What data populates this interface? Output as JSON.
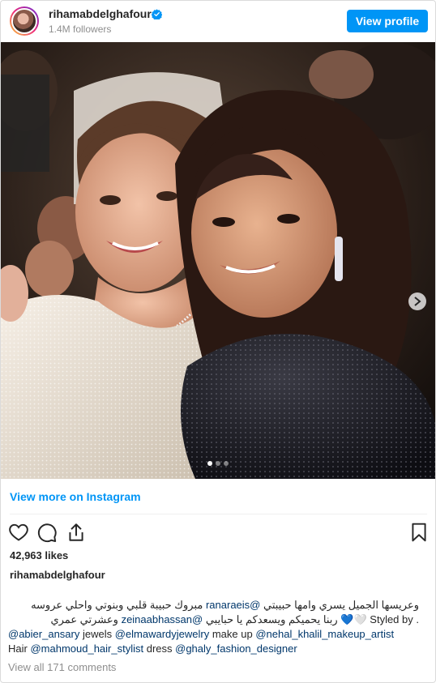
{
  "header": {
    "username": "rihamabdelghafour",
    "followers": "1.4M followers",
    "view_profile_label": "View profile"
  },
  "carousel": {
    "slide_count": 3,
    "active_index": 0
  },
  "view_more_label": "View more on Instagram",
  "likes": "42,963 likes",
  "caption": {
    "username": "rihamabdelghafour",
    "line1_text": "وعريسها الجميل يسري وامها حبيبتي ",
    "line1_mention": "@ranaraeis",
    "line1_text2": " مبروك حبيبة قلبي وبنوتي واحلي عروسه",
    "line2_prefix": ". Styled by ",
    "line2_emoji": "🤍💙",
    "line2_text": " ربنا يحميكم ويسعدكم يا حبايبي ",
    "line2_mention": "@zeinaabhassan",
    "line2_text2": " وعشرتي عمري",
    "line3_mention1": "@abier_ansary",
    "line3_text1": " jewels ",
    "line3_mention2": "@elmawardyjewelry",
    "line3_text2": " make up ",
    "line3_mention3": "@nehal_khalil_makeup_artist",
    "line4_text1": "Hair ",
    "line4_mention1": "@mahmoud_hair_stylist",
    "line4_text2": " dress ",
    "line4_mention2": "@ghaly_fashion_designer"
  },
  "view_all_comments": "View all 171 comments",
  "colors": {
    "accent": "#0095f6",
    "mention": "#00376b",
    "muted": "#8e8e8e"
  }
}
